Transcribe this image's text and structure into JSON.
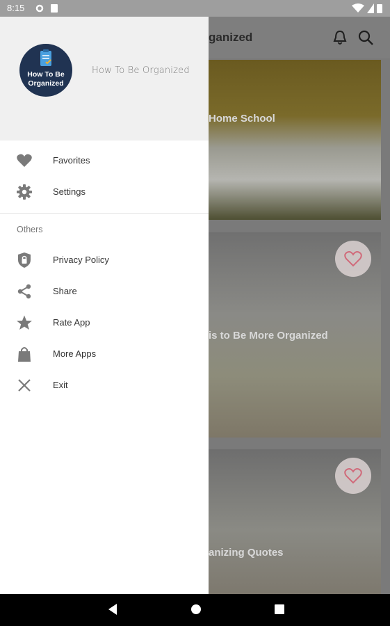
{
  "status_bar": {
    "time": "8:15"
  },
  "app_bar": {
    "title_visible": "ganized"
  },
  "cards": [
    {
      "title": "Home School"
    },
    {
      "title": "is to Be More Organized"
    },
    {
      "title": "anizing Quotes"
    }
  ],
  "drawer": {
    "logo_line1": "How To Be",
    "logo_line2": "Organized",
    "app_name": "How To Be Organized",
    "items": [
      {
        "label": "Favorites",
        "icon": "heart-icon"
      },
      {
        "label": "Settings",
        "icon": "gear-icon"
      }
    ],
    "section_label": "Others",
    "others": [
      {
        "label": "Privacy Policy",
        "icon": "shield-icon"
      },
      {
        "label": "Share",
        "icon": "share-icon"
      },
      {
        "label": "Rate App",
        "icon": "star-icon"
      },
      {
        "label": "More Apps",
        "icon": "shopping-bag-icon"
      },
      {
        "label": "Exit",
        "icon": "close-icon"
      }
    ]
  },
  "colors": {
    "drawer_header_bg": "#f0f0f0",
    "logo_bg": "#203352",
    "scrim": "#7a7a7a"
  }
}
